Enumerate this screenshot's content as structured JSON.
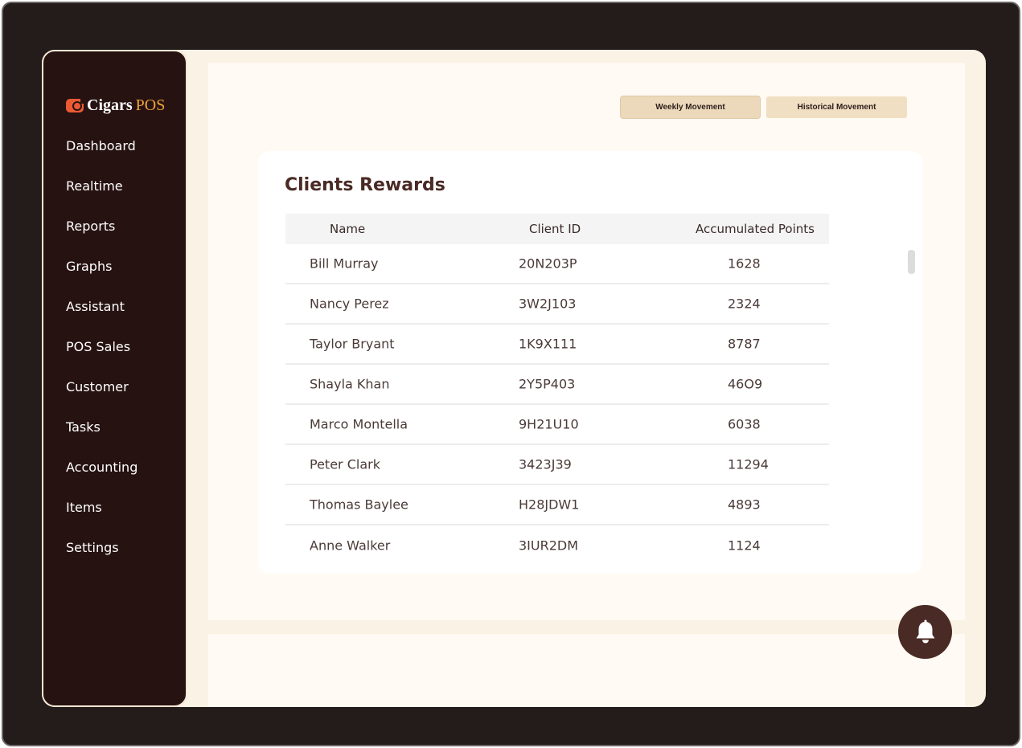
{
  "app": {
    "logo_primary": "Cigars",
    "logo_secondary": "POS"
  },
  "sidebar": {
    "items": [
      {
        "label": "Dashboard"
      },
      {
        "label": "Realtime"
      },
      {
        "label": "Reports"
      },
      {
        "label": "Graphs"
      },
      {
        "label": "Assistant"
      },
      {
        "label": "POS Sales"
      },
      {
        "label": "Customer"
      },
      {
        "label": "Tasks"
      },
      {
        "label": "Accounting"
      },
      {
        "label": "Items"
      },
      {
        "label": "Settings"
      }
    ]
  },
  "toolbar": {
    "weekly_label": "Weekly Movement",
    "historical_label": "Historical Movement"
  },
  "rewards": {
    "title": "Clients Rewards",
    "columns": [
      "Name",
      "Client ID",
      "Accumulated Points"
    ],
    "rows": [
      {
        "name": "Bill Murray",
        "client_id": "20N203P",
        "points": "1628"
      },
      {
        "name": "Nancy Perez",
        "client_id": "3W2J103",
        "points": "2324"
      },
      {
        "name": "Taylor Bryant",
        "client_id": "1K9X111",
        "points": "8787"
      },
      {
        "name": "Shayla Khan",
        "client_id": "2Y5P403",
        "points": "46O9"
      },
      {
        "name": "Marco Montella",
        "client_id": "9H21U10",
        "points": "6038"
      },
      {
        "name": "Peter  Clark",
        "client_id": "3423J39",
        "points": "11294"
      },
      {
        "name": "Thomas Baylee",
        "client_id": "H28JDW1",
        "points": "4893"
      },
      {
        "name": "Anne Walker",
        "client_id": "3IUR2DM",
        "points": "1124"
      }
    ]
  },
  "colors": {
    "sidebar_bg": "#261211",
    "accent_orange": "#ec5a34",
    "logo_gold": "#f0a43b",
    "title_brown": "#4a2a25",
    "content_bg": "#fffaf3"
  },
  "icons": {
    "logo": "cigar-logo-icon",
    "notifications": "bell-icon"
  }
}
